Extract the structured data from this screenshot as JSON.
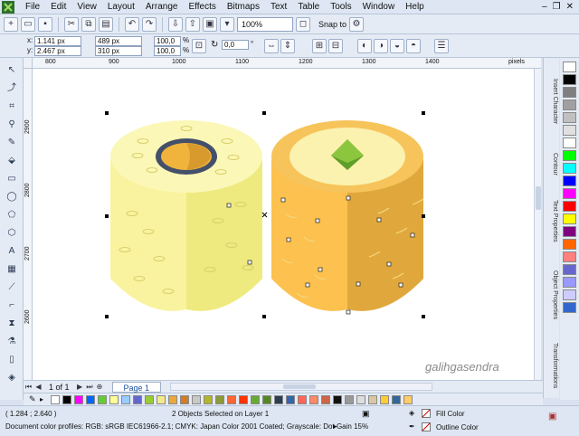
{
  "menu": [
    "File",
    "Edit",
    "View",
    "Layout",
    "Arrange",
    "Effects",
    "Bitmaps",
    "Text",
    "Table",
    "Tools",
    "Window",
    "Help"
  ],
  "toolbar": {
    "zoom": "100%",
    "snap": "Snap to"
  },
  "propbar": {
    "x": "1.141 px",
    "y": "2.467 px",
    "w": "489 px",
    "h": "310 px",
    "sx": "100,0",
    "sy": "100,0",
    "pct1": "%",
    "pct2": "%",
    "angle": "0,0",
    "deg": "°"
  },
  "ruler": {
    "h": [
      "800",
      "900",
      "1000",
      "1100",
      "1200",
      "1300",
      "1400"
    ],
    "unit": "pixels",
    "v": [
      "2900",
      "2800",
      "2700",
      "2600"
    ]
  },
  "docker_tabs": [
    "Insert Character",
    "Contour",
    "Text Properties",
    "Object Properties",
    "Transformations"
  ],
  "pagebar": {
    "page_count": "1 of 1",
    "page_tab": "Page 1"
  },
  "watermark": "galihgasendra",
  "status": {
    "coords": "( 1.284 ; 2.640 )",
    "selection": "2 Objects Selected on Layer 1",
    "profile": "Document color profiles: RGB: sRGB IEC61966-2.1; CMYK: Japan Color 2001 Coated; Grayscale: Dot Gain 15%",
    "fill": "Fill Color",
    "outline": "Outline Color"
  },
  "palette_colors": [
    "#ffffff",
    "#000000",
    "#7f7f7f",
    "#a0a0a0",
    "#c0c0c0",
    "#e0e0e0",
    "#ffffff",
    "#00ff00",
    "#00ffff",
    "#0000ff",
    "#ff00ff",
    "#ff0000",
    "#ffff00",
    "#800080",
    "#ff6600",
    "#ff8080",
    "#6666cc",
    "#9999ff",
    "#ccccff",
    "#3366cc"
  ],
  "strip_colors": [
    "#ffffff",
    "#000000",
    "#ff00ff",
    "#0066ff",
    "#66cc33",
    "#ffff99",
    "#99ccff",
    "#6666cc",
    "#99cc33",
    "#f5e98a",
    "#e8a83a",
    "#d07c28",
    "#c8c8c8",
    "#b5b52a",
    "#8c9a3a",
    "#ff6633",
    "#ff3300",
    "#66aa33",
    "#558822",
    "#2c3e50",
    "#3366aa",
    "#ff6655",
    "#ff8866",
    "#cc6644",
    "#111111",
    "#999999",
    "#dddddd",
    "#d8c8a0",
    "#ffcc33",
    "#336699",
    "#ffcc66"
  ]
}
